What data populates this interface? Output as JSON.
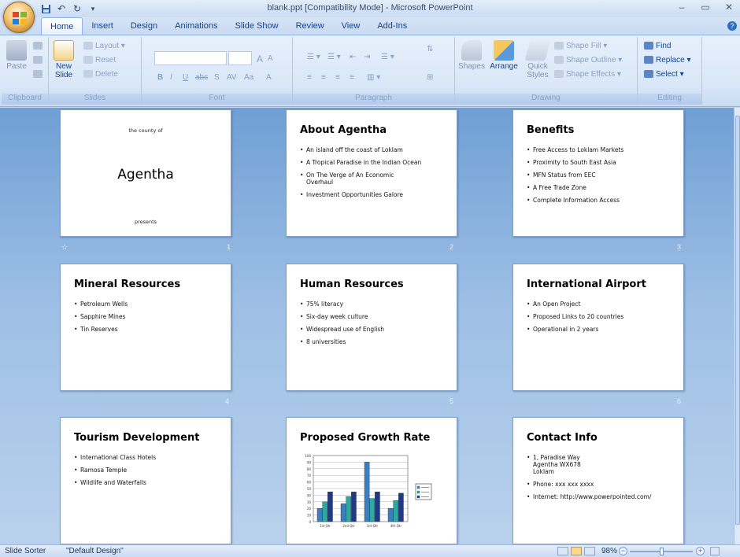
{
  "window": {
    "title": "blank.ppt [Compatibility Mode] - Microsoft PowerPoint",
    "controls": [
      "–",
      "▭",
      "✕"
    ]
  },
  "tabs": [
    "Home",
    "Insert",
    "Design",
    "Animations",
    "Slide Show",
    "Review",
    "View",
    "Add-Ins"
  ],
  "ribbon": {
    "clipboard": {
      "paste": "Paste",
      "label": "Clipboard"
    },
    "slides": {
      "new_slide": "New Slide",
      "layout": "Layout",
      "reset": "Reset",
      "delete": "Delete",
      "label": "Slides"
    },
    "font": {
      "label": "Font",
      "grow": "A",
      "shrink": "A",
      "bold": "B",
      "italic": "I",
      "underline": "U",
      "strike": "abc",
      "shadow": "S",
      "spacing": "AV",
      "case": "Aa",
      "color": "A"
    },
    "paragraph": {
      "label": "Paragraph"
    },
    "drawing": {
      "shapes": "Shapes",
      "arrange": "Arrange",
      "quick_styles": "Quick Styles",
      "shape_fill": "Shape Fill",
      "shape_outline": "Shape Outline",
      "shape_effects": "Shape Effects",
      "label": "Drawing"
    },
    "editing": {
      "find": "Find",
      "replace": "Replace",
      "select": "Select",
      "label": "Editing"
    }
  },
  "slides": [
    {
      "number": "1",
      "type": "title",
      "pre": "the county of",
      "title": "Agentha",
      "post": "presents",
      "corner_mark": "☆"
    },
    {
      "number": "2",
      "title": "About Agentha",
      "bullets": [
        "An island off the coast of Loklam",
        "A Tropical Paradise in the Indian Ocean",
        "On The Verge of An Economic Overhaul",
        "Investment Opportunities Galore"
      ]
    },
    {
      "number": "3",
      "title": "Benefits",
      "bullets": [
        "Free Access to Loklam Markets",
        "Proximity to South East Asia",
        "MFN Status from EEC",
        "A Free Trade Zone",
        "Complete Information Access"
      ]
    },
    {
      "number": "4",
      "title": "Mineral Resources",
      "bullets": [
        "Petroleum Wells",
        "Sapphire Mines",
        "Tin Reserves"
      ]
    },
    {
      "number": "5",
      "title": "Human Resources",
      "bullets": [
        "75% literacy",
        "Six-day week culture",
        "Widespread use of English",
        "8 universities"
      ]
    },
    {
      "number": "6",
      "title": "International Airport",
      "bullets": [
        "An Open Project",
        "Proposed Links to 20 countries",
        "Operational in 2 years"
      ]
    },
    {
      "number": "7",
      "title": "Tourism Development",
      "bullets": [
        "International Class Hotels",
        "Ramosa Temple",
        "Wildlife and Waterfalls"
      ]
    },
    {
      "number": "8",
      "title": "Proposed Growth Rate",
      "type": "chart"
    },
    {
      "number": "9",
      "title": "Contact Info",
      "bullets": [
        "1, Paradise Way\nAgentha WX678\nLoklam",
        "Phone: xxx xxx xxxx",
        "Internet: http://www.powerpointed.com/"
      ]
    }
  ],
  "chart_data": {
    "type": "bar",
    "categories": [
      "1st Qtr",
      "2nd Qtr",
      "3rd Qtr",
      "4th Qtr"
    ],
    "series": [
      {
        "values": [
          20,
          27,
          90,
          20
        ],
        "color": "#3a7fbf"
      },
      {
        "values": [
          30,
          38,
          35,
          32
        ],
        "color": "#2fa8a0"
      },
      {
        "values": [
          45,
          45,
          45,
          43
        ],
        "color": "#1e3a8a"
      }
    ],
    "ylim": [
      0,
      100
    ],
    "grid": true,
    "legend": "right"
  },
  "status": {
    "view": "Slide Sorter",
    "theme": "\"Default Design\"",
    "zoom": "98%"
  }
}
